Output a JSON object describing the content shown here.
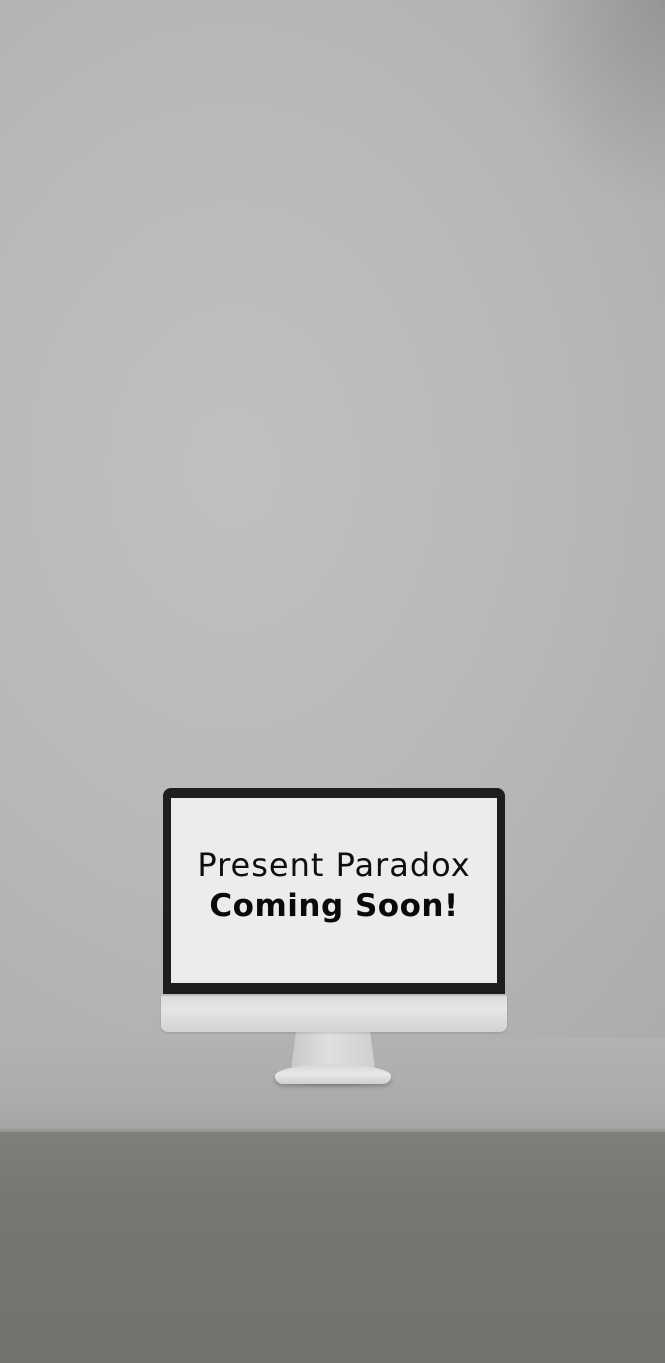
{
  "screen": {
    "headline": "Present Paradox",
    "subline": "Coming Soon!"
  },
  "colors": {
    "wall": "#b8b8b6",
    "desk_top": "#acacaa",
    "desk_front": "#777672",
    "screen_bg": "#ececea",
    "bezel": "#1e1e1e",
    "text": "#0e0e0e"
  }
}
